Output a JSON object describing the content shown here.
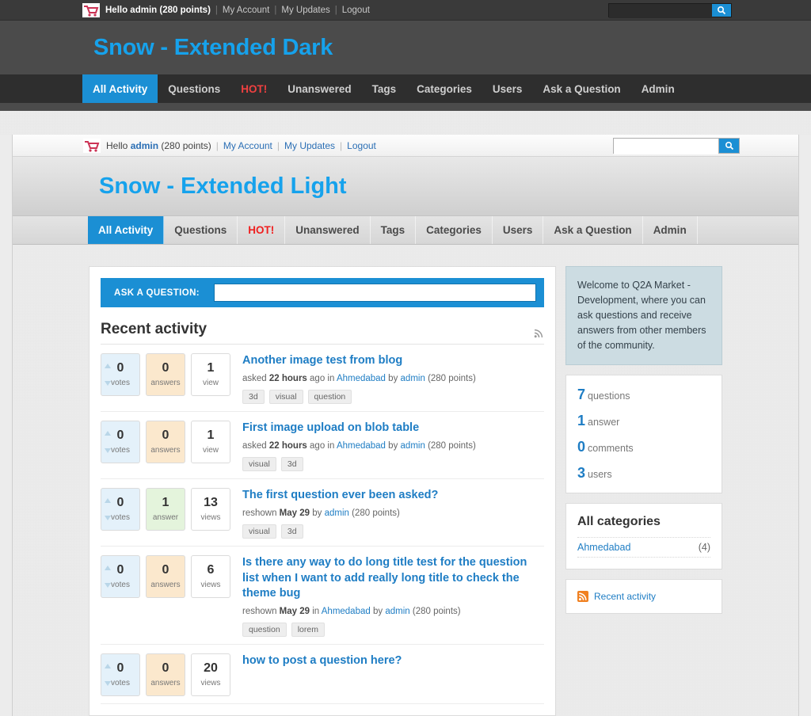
{
  "dark": {
    "title": "Snow - Extended Dark",
    "topbar": {
      "hello": "Hello admin (280 points)",
      "my_account": "My Account",
      "my_updates": "My Updates",
      "logout": "Logout"
    },
    "search": {
      "value": "",
      "placeholder": ""
    },
    "nav": [
      {
        "label": "All Activity",
        "state": "active"
      },
      {
        "label": "Questions",
        "state": "normal"
      },
      {
        "label": "HOT!",
        "state": "hot"
      },
      {
        "label": "Unanswered",
        "state": "normal"
      },
      {
        "label": "Tags",
        "state": "normal"
      },
      {
        "label": "Categories",
        "state": "normal"
      },
      {
        "label": "Users",
        "state": "normal"
      },
      {
        "label": "Ask a Question",
        "state": "normal"
      },
      {
        "label": "Admin",
        "state": "normal"
      }
    ]
  },
  "light": {
    "title": "Snow - Extended Light",
    "topbar": {
      "hello_prefix": "Hello ",
      "username": "admin",
      "points": " (280 points)",
      "my_account": "My Account",
      "my_updates": "My Updates",
      "logout": "Logout"
    },
    "search": {
      "value": "",
      "placeholder": ""
    },
    "nav": [
      {
        "label": "All Activity",
        "state": "active"
      },
      {
        "label": "Questions",
        "state": "normal"
      },
      {
        "label": "HOT!",
        "state": "hot"
      },
      {
        "label": "Unanswered",
        "state": "normal"
      },
      {
        "label": "Tags",
        "state": "normal"
      },
      {
        "label": "Categories",
        "state": "normal"
      },
      {
        "label": "Users",
        "state": "normal"
      },
      {
        "label": "Ask a Question",
        "state": "normal"
      },
      {
        "label": "Admin",
        "state": "normal"
      }
    ]
  },
  "ask_bar": {
    "label": "ASK A QUESTION:",
    "value": "",
    "placeholder": ""
  },
  "main": {
    "heading": "Recent activity",
    "rss_icon": "rss-icon",
    "questions": [
      {
        "votes": "0",
        "votes_label": "votes",
        "answers": "0",
        "answers_label": "answers",
        "answers_style": "orange",
        "views": "1",
        "views_label": "view",
        "title": "Another image test from blog",
        "meta_action": "asked",
        "meta_time": "22 hours",
        "meta_mid": "ago in",
        "meta_category": "Ahmedabad",
        "meta_by": "by",
        "meta_user": "admin",
        "meta_points": "(280 points)",
        "tags": [
          "3d",
          "visual",
          "question"
        ]
      },
      {
        "votes": "0",
        "votes_label": "votes",
        "answers": "0",
        "answers_label": "answers",
        "answers_style": "orange",
        "views": "1",
        "views_label": "view",
        "title": "First image upload on blob table",
        "meta_action": "asked",
        "meta_time": "22 hours",
        "meta_mid": "ago in",
        "meta_category": "Ahmedabad",
        "meta_by": "by",
        "meta_user": "admin",
        "meta_points": "(280 points)",
        "tags": [
          "visual",
          "3d"
        ]
      },
      {
        "votes": "0",
        "votes_label": "votes",
        "answers": "1",
        "answers_label": "answer",
        "answers_style": "green",
        "views": "13",
        "views_label": "views",
        "title": "The first question ever been asked?",
        "meta_action": "reshown",
        "meta_time": "May 29",
        "meta_mid": "",
        "meta_category": "",
        "meta_by": "by",
        "meta_user": "admin",
        "meta_points": "(280 points)",
        "tags": [
          "visual",
          "3d"
        ]
      },
      {
        "votes": "0",
        "votes_label": "votes",
        "answers": "0",
        "answers_label": "answers",
        "answers_style": "orange",
        "views": "6",
        "views_label": "views",
        "title": "Is there any way to do long title test for the question list when I want to add really long title to check the theme bug",
        "meta_action": "reshown",
        "meta_time": "May 29",
        "meta_mid": "in",
        "meta_category": "Ahmedabad",
        "meta_by": "by",
        "meta_user": "admin",
        "meta_points": "(280 points)",
        "tags": [
          "question",
          "lorem"
        ]
      },
      {
        "votes": "0",
        "votes_label": "votes",
        "answers": "0",
        "answers_label": "answers",
        "answers_style": "orange",
        "views": "20",
        "views_label": "views",
        "title": "how to post a question here?",
        "meta_action": "",
        "meta_time": "",
        "meta_mid": "",
        "meta_category": "",
        "meta_by": "",
        "meta_user": "",
        "meta_points": "",
        "tags": []
      }
    ]
  },
  "sidebar": {
    "welcome": "Welcome to Q2A Market - Development, where you can ask questions and receive answers from other members of the community.",
    "stats": [
      {
        "num": "7",
        "label": "questions"
      },
      {
        "num": "1",
        "label": "answer"
      },
      {
        "num": "0",
        "label": "comments"
      },
      {
        "num": "3",
        "label": "users"
      }
    ],
    "categories_title": "All categories",
    "categories": [
      {
        "name": "Ahmedabad",
        "count": "(4)"
      }
    ],
    "recent_activity_link": "Recent activity"
  },
  "colors": {
    "accent_blue": "#1b8fd4",
    "title_blue": "#16a2ec",
    "link_blue": "#1e7dc4",
    "hot_red": "#ef2020",
    "dark_bg": "#4b4b4b",
    "dark_nav": "#2e2e2e"
  }
}
